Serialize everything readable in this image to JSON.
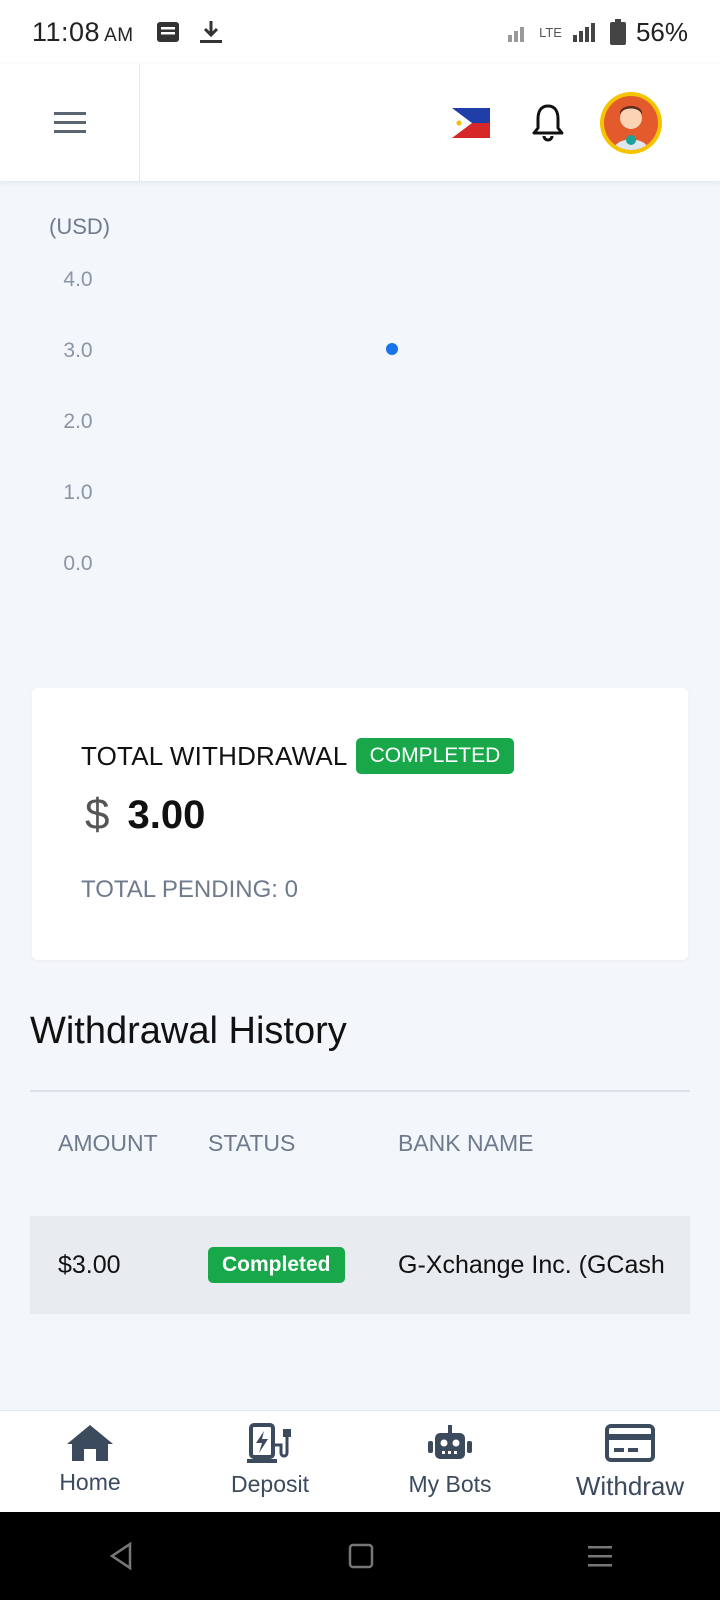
{
  "status_bar": {
    "time": "11:08",
    "ampm": "AM",
    "network": "LTE",
    "battery": "56%"
  },
  "header": {
    "icons": [
      "menu-icon",
      "philippines-flag-icon",
      "bell-icon",
      "avatar"
    ]
  },
  "chart_data": {
    "type": "scatter",
    "ylabel": "(USD)",
    "y_ticks": [
      "4.0",
      "3.0",
      "2.0",
      "1.0",
      "0.0"
    ],
    "ylim": [
      0,
      4
    ],
    "points": [
      {
        "y": 3.0,
        "color": "#1a73e8"
      }
    ]
  },
  "summary": {
    "title": "TOTAL WITHDRAWAL",
    "badge": "COMPLETED",
    "currency_symbol": "$",
    "amount": "3.00",
    "pending": "TOTAL PENDING: 0"
  },
  "history": {
    "title": "Withdrawal History",
    "columns": [
      "AMOUNT",
      "STATUS",
      "BANK NAME"
    ],
    "rows": [
      {
        "amount": "$3.00",
        "status": "Completed",
        "bank": "G-Xchange Inc. (GCash"
      }
    ]
  },
  "bottom_nav": [
    {
      "label": "Home",
      "icon": "home-icon"
    },
    {
      "label": "Deposit",
      "icon": "charging-station-icon"
    },
    {
      "label": "My Bots",
      "icon": "robot-icon"
    },
    {
      "label": "Withdraw",
      "icon": "credit-card-icon",
      "active": true
    }
  ],
  "colors": {
    "accent_blue": "#1a73e8",
    "success_green": "#18a84a",
    "nav_icon": "#3c4a5e"
  }
}
